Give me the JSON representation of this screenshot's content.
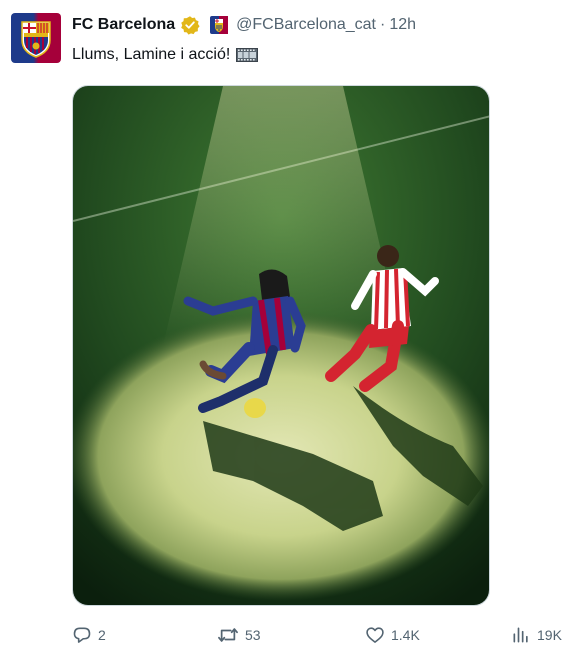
{
  "tweet": {
    "author": {
      "display_name": "FC Barcelona",
      "handle": "@FCBarcelona_cat",
      "verified_badge": "gold-verified-icon",
      "avatar": "fc-barcelona-crest"
    },
    "separator": "·",
    "time": "12h",
    "text": "Llums, Lamine i acció!",
    "text_emoji": "film-frames-icon",
    "media": {
      "type": "image",
      "description_icon": "football-spotlight-photo"
    },
    "actions": {
      "reply_count": "2",
      "retweet_count": "53",
      "like_count": "1.4K",
      "view_count": "19K"
    }
  },
  "colors": {
    "text_primary": "#0f1419",
    "text_secondary": "#536471",
    "verified_gold": "#e2b719",
    "barca_blue": "#1e3a8a",
    "barca_red": "#a5003a",
    "pitch_green": "#2f5e2a"
  }
}
